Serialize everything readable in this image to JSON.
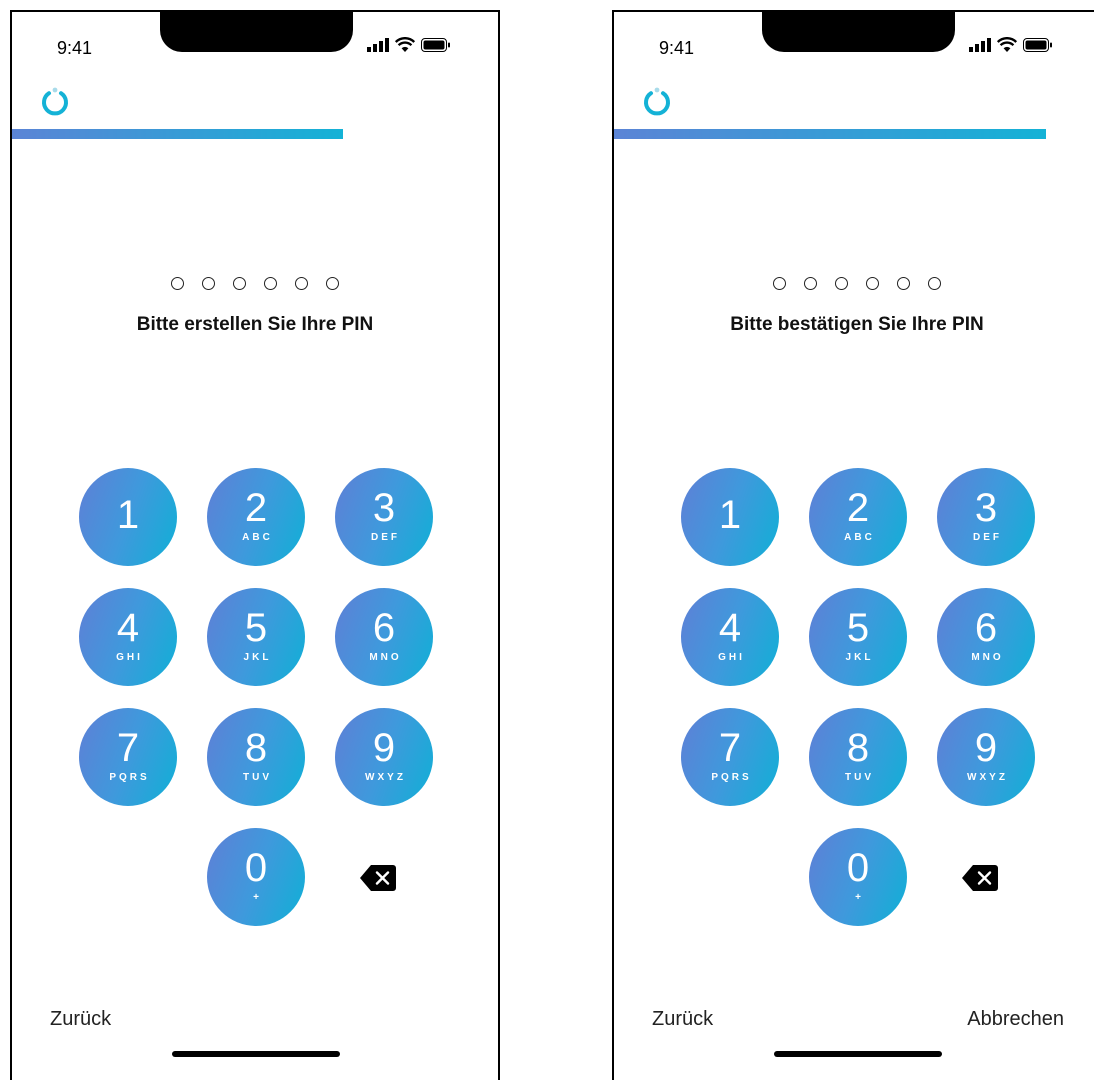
{
  "screens": [
    {
      "status_bar": {
        "time": "9:41"
      },
      "prompt": "Bitte erstellen Sie Ihre PIN",
      "progress_fraction": 0.68,
      "pin_length": 6,
      "footer": {
        "back_label": "Zurück",
        "cancel_label": ""
      }
    },
    {
      "status_bar": {
        "time": "9:41"
      },
      "prompt": "Bitte bestätigen Sie Ihre PIN",
      "progress_fraction": 0.88,
      "pin_length": 6,
      "footer": {
        "back_label": "Zurück",
        "cancel_label": "Abbrechen"
      }
    }
  ],
  "keypad": [
    {
      "digit": "1",
      "letters": ""
    },
    {
      "digit": "2",
      "letters": "ABC"
    },
    {
      "digit": "3",
      "letters": "DEF"
    },
    {
      "digit": "4",
      "letters": "GHI"
    },
    {
      "digit": "5",
      "letters": "JKL"
    },
    {
      "digit": "6",
      "letters": "MNO"
    },
    {
      "digit": "7",
      "letters": "PQRS"
    },
    {
      "digit": "8",
      "letters": "TUV"
    },
    {
      "digit": "9",
      "letters": "WXYZ"
    },
    {
      "digit": "0",
      "letters": "+"
    }
  ],
  "icons": {
    "logo": "power-ring-logo",
    "signal": "cellular-signal-icon",
    "wifi": "wifi-icon",
    "battery": "battery-icon",
    "backspace": "backspace-icon"
  },
  "colors": {
    "gradient_start": "#5f7fd6",
    "gradient_end": "#0fb0d6",
    "accent": "#14b2d6"
  }
}
